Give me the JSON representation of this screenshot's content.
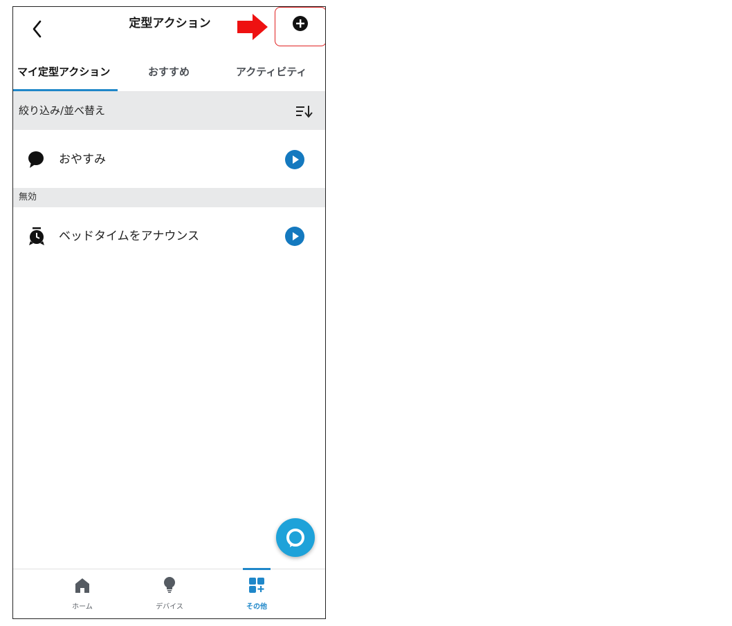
{
  "header": {
    "title": "定型アクション",
    "back_icon": "chevron-left-icon",
    "add_icon": "plus-circle-icon",
    "arrow_icon": "red-right-arrow-icon"
  },
  "tabs": [
    {
      "label": "マイ定型アクション",
      "active": true
    },
    {
      "label": "おすすめ",
      "active": false
    },
    {
      "label": "アクティビティ",
      "active": false
    }
  ],
  "filter": {
    "label": "絞り込み/並べ替え",
    "icon": "sort-icon"
  },
  "routines": [
    {
      "label": "おやすみ",
      "icon": "speech-bubble-icon",
      "action_icon": "play-icon"
    }
  ],
  "disabled_section": {
    "label": "無効",
    "routines": [
      {
        "label": "ベッドタイムをアナウンス",
        "icon": "alarm-clock-icon",
        "action_icon": "play-icon"
      }
    ]
  },
  "fab": {
    "icon": "alexa-ring-icon"
  },
  "bottom_nav": [
    {
      "label": "ホーム",
      "icon": "home-icon",
      "active": false
    },
    {
      "label": "デバイス",
      "icon": "bulb-icon",
      "active": false
    },
    {
      "label": "その他",
      "icon": "more-grid-icon",
      "active": true
    }
  ],
  "colors": {
    "accent": "#1f87c9",
    "play": "#1479bf",
    "highlight": "#e02020",
    "fab": "#1ea2d9",
    "section_bg": "#e8e9ea"
  }
}
